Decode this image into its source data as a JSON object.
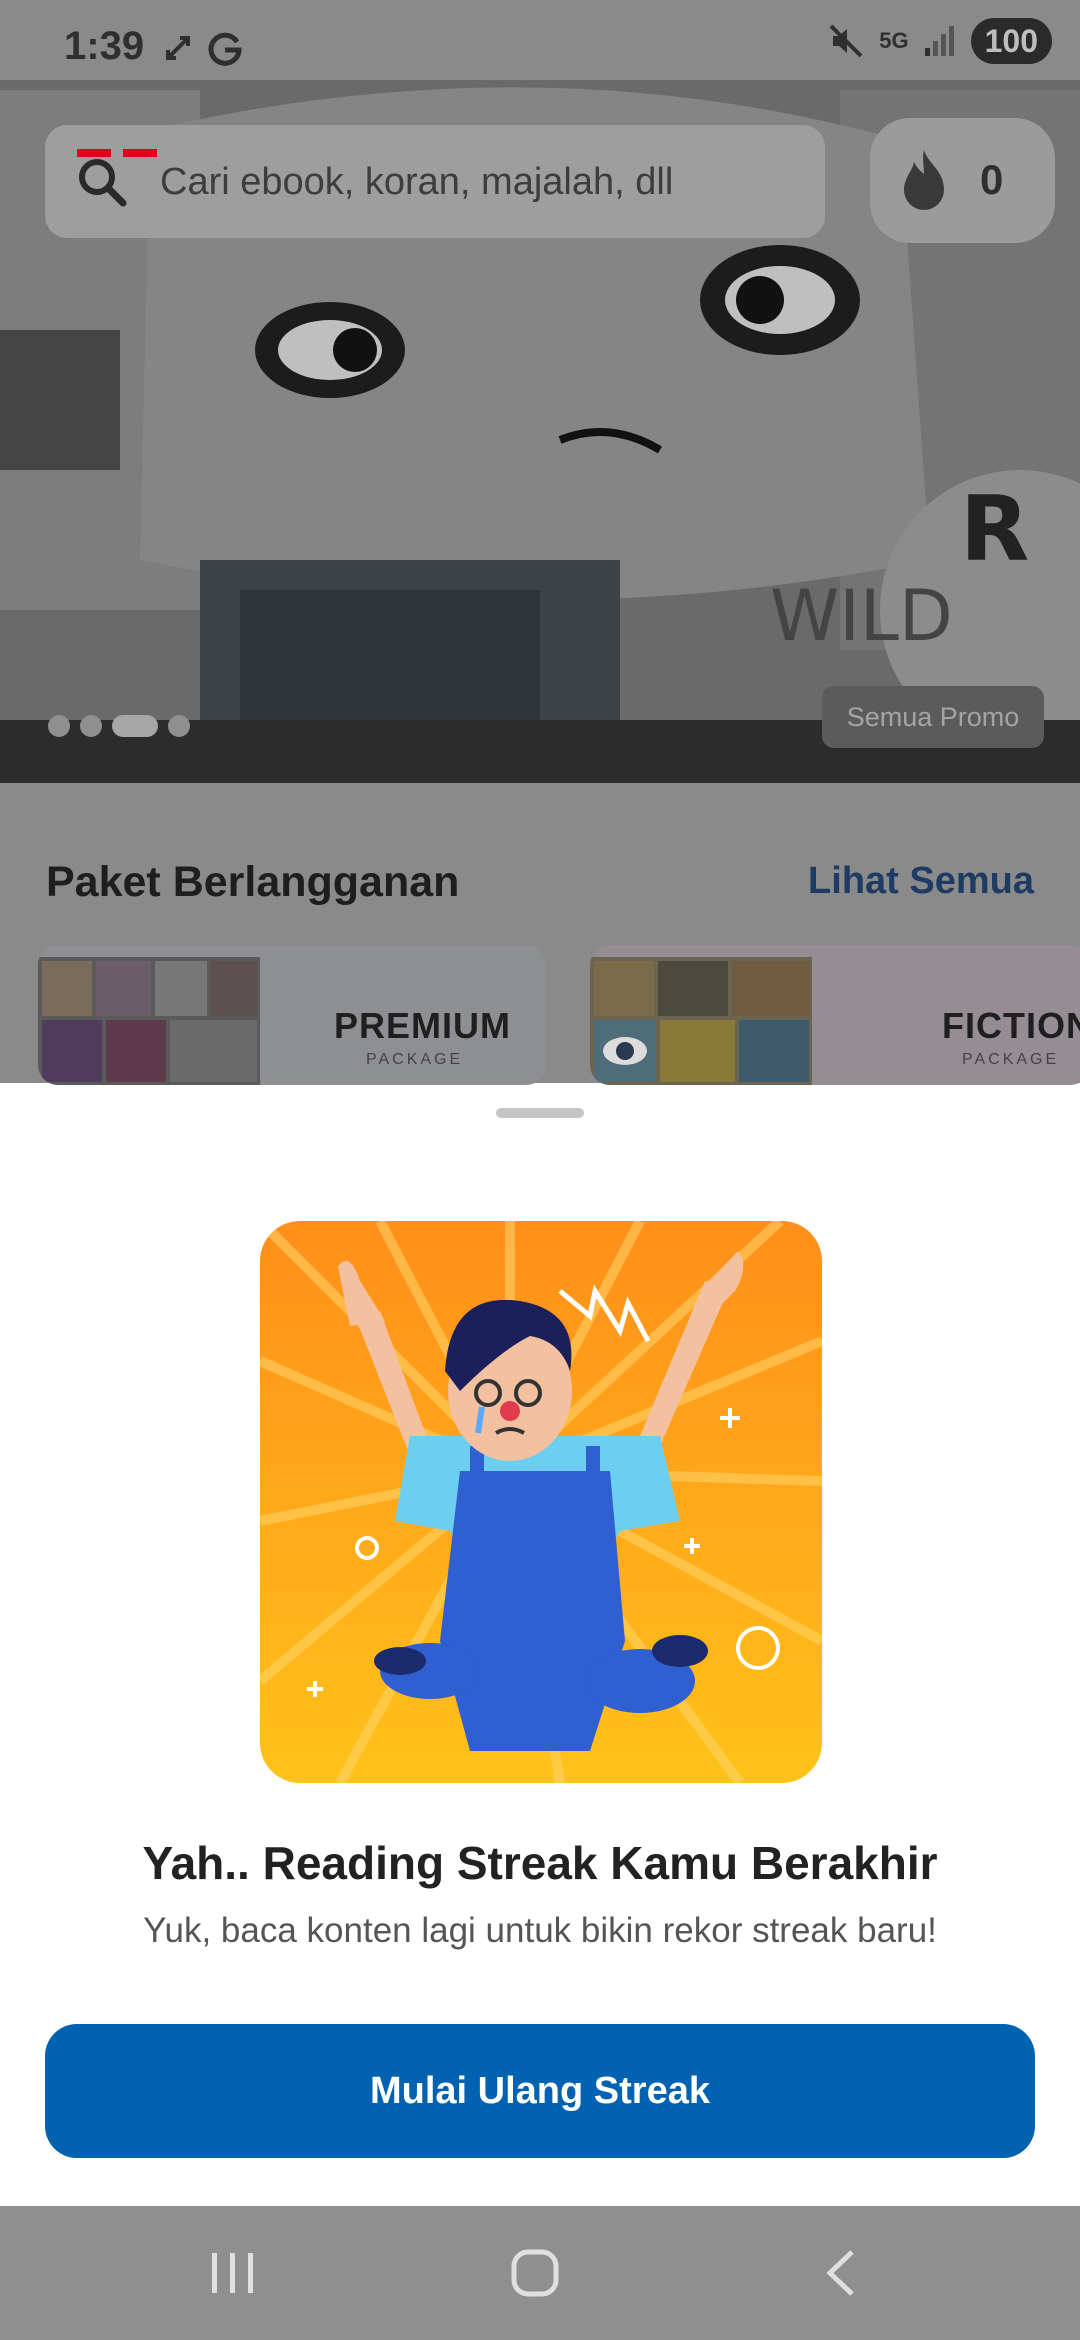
{
  "status_bar": {
    "time": "1:39",
    "network": "5G",
    "battery": "100"
  },
  "search": {
    "placeholder": "Cari ebook, koran, majalah, dll"
  },
  "streak": {
    "count": "0"
  },
  "banner": {
    "promo_button": "Semua Promo",
    "dots_count": 4,
    "active_dot": 3
  },
  "subscriptions": {
    "title": "Paket Berlangganan",
    "see_all": "Lihat Semua",
    "packages": [
      {
        "label": "PREMIUM",
        "sub": "PACKAGE"
      },
      {
        "label": "FICTION",
        "sub": "PACKAGE"
      }
    ]
  },
  "sheet": {
    "title": "Yah.. Reading Streak Kamu Berakhir",
    "subtitle": "Yuk, baca konten lagi untuk bikin rekor streak baru!",
    "button": "Mulai Ulang Streak"
  },
  "colors": {
    "primary": "#0062b1",
    "illustration_orange": "#ff9a1f",
    "overall_blue": "#2f5fd0"
  },
  "icons": {
    "search": "search-icon",
    "flame": "flame-icon",
    "nav_recents": "recents-icon",
    "nav_home": "home-icon",
    "nav_back": "back-icon"
  }
}
